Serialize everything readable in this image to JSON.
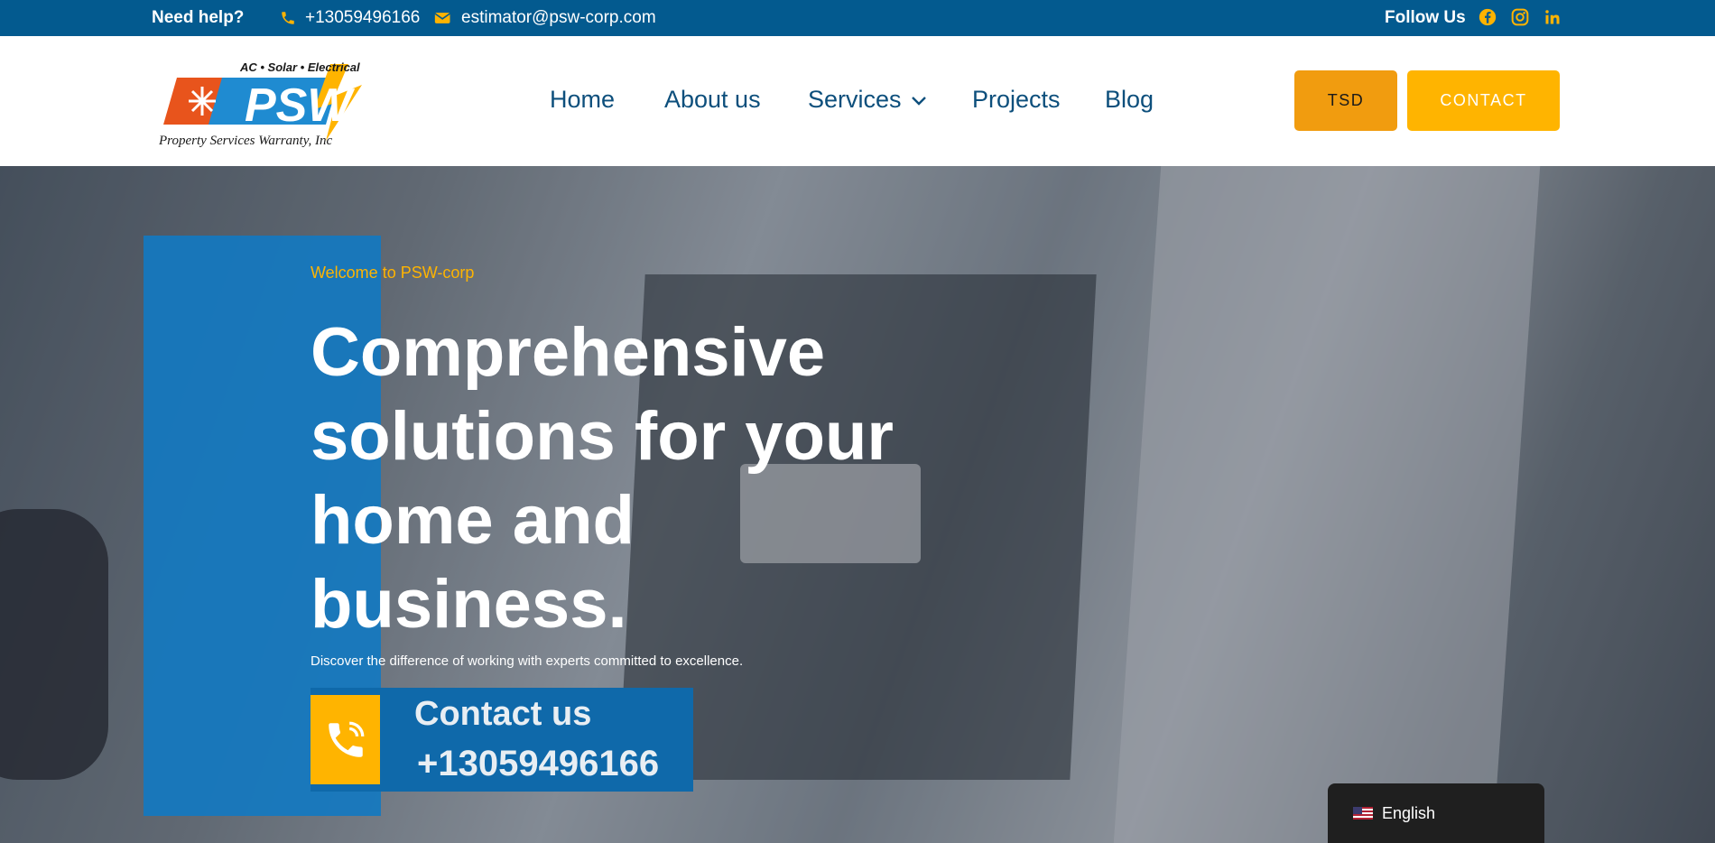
{
  "topbar": {
    "help": "Need help?",
    "phone": "+13059496166",
    "email": "estimator@psw-corp.com",
    "follow": "Follow Us",
    "social_icons": [
      "facebook-icon",
      "instagram-icon",
      "linkedin-icon"
    ]
  },
  "logo": {
    "tagline_top": "AC • Solar • Electrical",
    "brand": "PSW",
    "tagline_bottom": "Property Services Warranty, Inc"
  },
  "nav": {
    "items": [
      "Home",
      "About us",
      "Services",
      "Projects",
      "Blog"
    ]
  },
  "buttons": {
    "tsd": "TSD",
    "contact": "CONTACT"
  },
  "hero": {
    "welcome": "Welcome to PSW-corp",
    "headline": [
      "Comprehensive",
      "solutions for your",
      "home and",
      "business."
    ],
    "subtitle": "Discover the difference of working with experts committed to excellence.",
    "cta_label": "Contact us",
    "cta_phone": "+13059496166"
  },
  "language": {
    "selected": "English"
  },
  "colors": {
    "topbar": "#035a8f",
    "accent": "#ffb400",
    "nav_text": "#0d4f7c",
    "hero_blue": "#1478c0"
  }
}
